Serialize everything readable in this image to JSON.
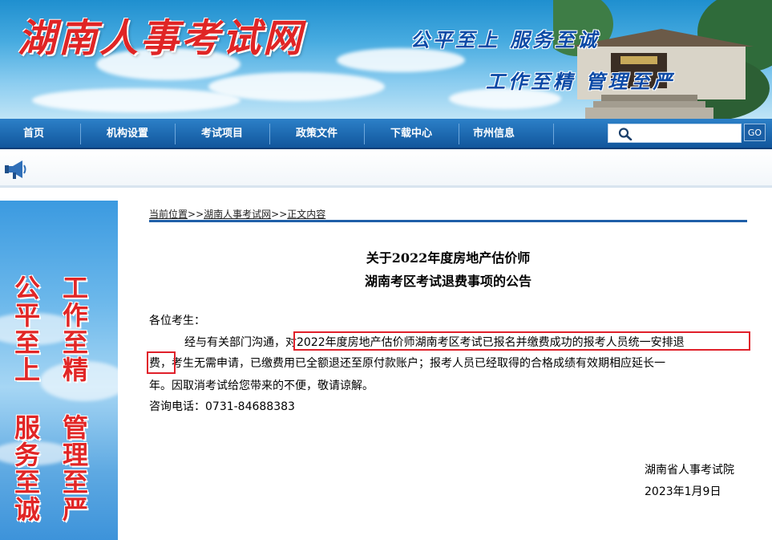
{
  "banner": {
    "site_title": "湖南人事考试网",
    "slogan_1": "公平至上 服务至诚",
    "slogan_2": "工作至精 管理至严"
  },
  "nav": {
    "items": [
      "首页",
      "机构设置",
      "考试项目",
      "政策文件",
      "下载中心",
      "市州信息"
    ],
    "search_placeholder": "",
    "go_label": "GO"
  },
  "side_panel": {
    "col_1": [
      "公",
      "平",
      "至",
      "上",
      "",
      "服",
      "务",
      "至",
      "诚"
    ],
    "col_2": [
      "工",
      "作",
      "至",
      "精",
      "",
      "管",
      "理",
      "至",
      "严"
    ]
  },
  "breadcrumb": {
    "label": "当前位置",
    "sep": ">>",
    "site": "湖南人事考试网",
    "page": "正文内容"
  },
  "article": {
    "title_line_1": "关于2022年度房地产估价师",
    "title_line_2": "湖南考区考试退费事项的公告",
    "greeting": "各位考生：",
    "line_1": "经与有关部门沟通，对2022年度房地产估价师湖南考区考试已报名并缴费成功的报考人员统一安排退",
    "line_2": "费，考生无需申请，已缴费用已全额退还至原付款账户；报考人员已经取得的合格成绩有效期相应延长一",
    "line_3": "年。因取消考试给您带来的不便，敬请谅解。",
    "hotline": "咨询电话：0731-84688383",
    "signature_org": "湖南省人事考试院",
    "signature_date": "2023年1月9日"
  },
  "colors": {
    "nav_blue": "#11569c",
    "title_red": "#e02525",
    "slogan_blue": "#0c4aa6",
    "highlight_red": "#e0202a",
    "rule_blue": "#1f5fa8"
  }
}
